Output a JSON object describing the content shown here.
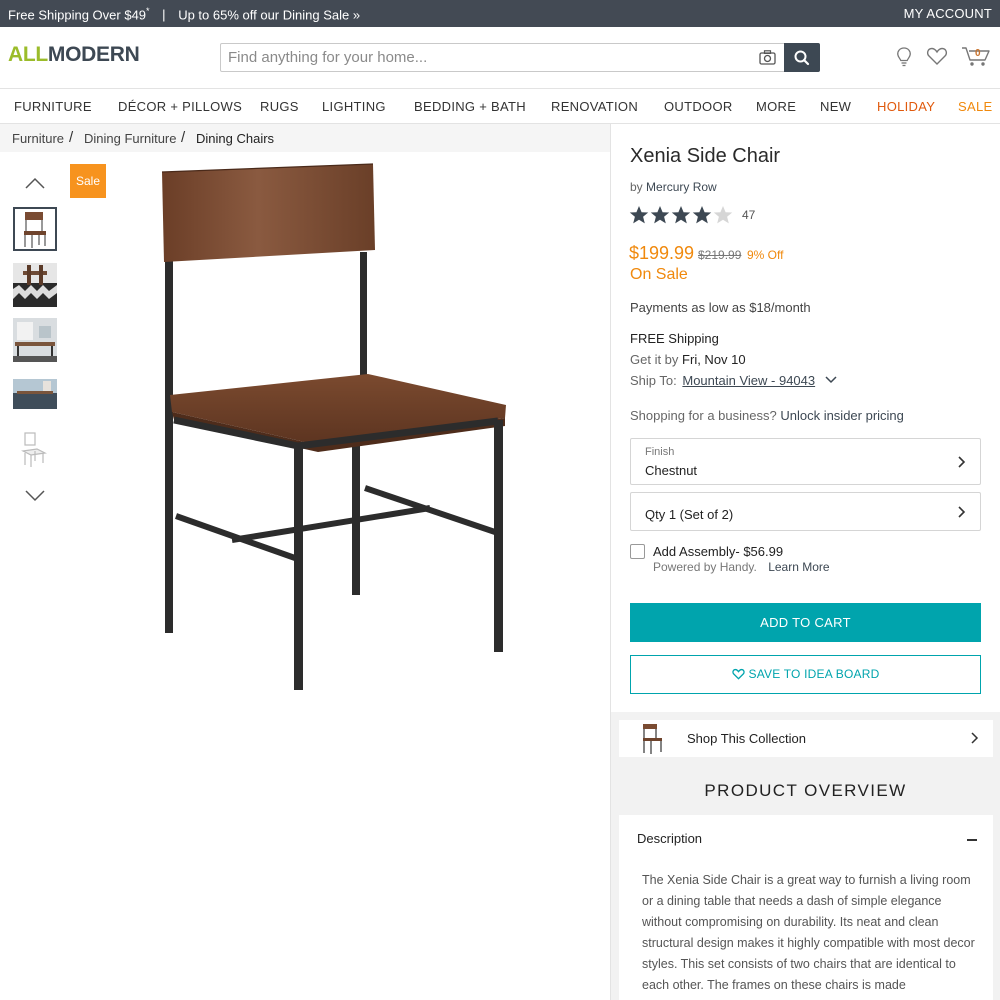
{
  "promo": {
    "left_text": "Free Shipping Over $49",
    "asterisk": "*",
    "separator": "|",
    "sale_text": "Up to 65% off our Dining Sale »",
    "account": "MY ACCOUNT"
  },
  "header": {
    "logo_all": "ALL",
    "logo_modern": "MODERN",
    "search_placeholder": "Find anything for your home...",
    "cart_count": "0"
  },
  "nav": {
    "items": [
      "FURNITURE",
      "DÉCOR + PILLOWS",
      "RUGS",
      "LIGHTING",
      "BEDDING + BATH",
      "RENOVATION",
      "OUTDOOR",
      "MORE",
      "NEW",
      "HOLIDAY",
      "SALE"
    ]
  },
  "breadcrumb": {
    "items": [
      "Furniture",
      "Dining Furniture",
      "Dining Chairs"
    ],
    "sep": "/"
  },
  "gallery": {
    "sale_badge": "Sale"
  },
  "product": {
    "title": "Xenia Side Chair",
    "by_prefix": "by",
    "brand": "Mercury Row",
    "rating": 4,
    "rating_max": 5,
    "review_count": "47",
    "price": "$199.99",
    "old_price": "$219.99",
    "discount": "9% Off",
    "on_sale": "On Sale",
    "payments": "Payments as low as $18/month",
    "free_shipping": "FREE Shipping",
    "get_it_prefix": "Get it by",
    "get_it_date": "Fri, Nov 10",
    "ship_to_label": "Ship To:",
    "ship_to_location": "Mountain View - 94043",
    "business_text": "Shopping for a business?",
    "business_link": "Unlock insider pricing",
    "finish_label": "Finish",
    "finish_value": "Chestnut",
    "qty_value": "Qty 1 (Set of 2)",
    "assembly": "Add Assembly- $56.99",
    "powered": "Powered by Handy.",
    "learn_more": "Learn More",
    "add_to_cart": "ADD TO CART",
    "save_idea": "SAVE TO IDEA BOARD"
  },
  "collection": {
    "label": "Shop This Collection"
  },
  "overview": {
    "heading": "PRODUCT OVERVIEW",
    "desc_heading": "Description",
    "desc_text": "The Xenia Side Chair is a great way to furnish a living room or a dining table that needs a dash of simple elegance without compromising on durability. Its neat and clean structural design makes it highly compatible with most decor styles. This set consists of two chairs that are identical to each other. The frames on these chairs is made"
  },
  "colors": {
    "accent_teal": "#00a4ad",
    "sale_orange": "#f0890d",
    "dark": "#3d4853",
    "logo_green": "#9bbc2a"
  }
}
